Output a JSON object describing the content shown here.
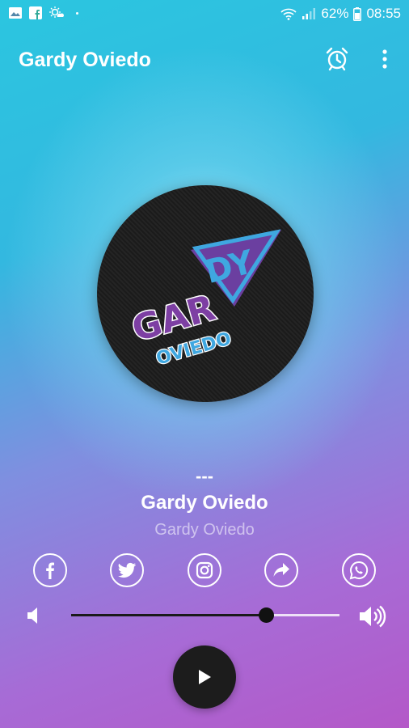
{
  "status_bar": {
    "battery": "62%",
    "time": "08:55",
    "icons": [
      "gallery-icon",
      "facebook-icon",
      "weather-icon",
      "dot-icon",
      "wifi-icon",
      "signal-icon",
      "battery-icon"
    ]
  },
  "app_bar": {
    "title": "Gardy Oviedo",
    "actions": [
      "alarm-icon",
      "more-icon"
    ]
  },
  "logo": {
    "line1": "GARDY",
    "line2": "OVIEDO",
    "colors": {
      "purple": "#6b3fa0",
      "blue": "#3fa7e0"
    }
  },
  "now_playing": {
    "title": "---",
    "station": "Gardy Oviedo",
    "artist": "Gardy Oviedo"
  },
  "social": [
    "facebook",
    "twitter",
    "instagram",
    "share",
    "whatsapp"
  ],
  "volume": {
    "level": 0.73
  },
  "player": {
    "state": "paused",
    "button": "play-icon"
  }
}
